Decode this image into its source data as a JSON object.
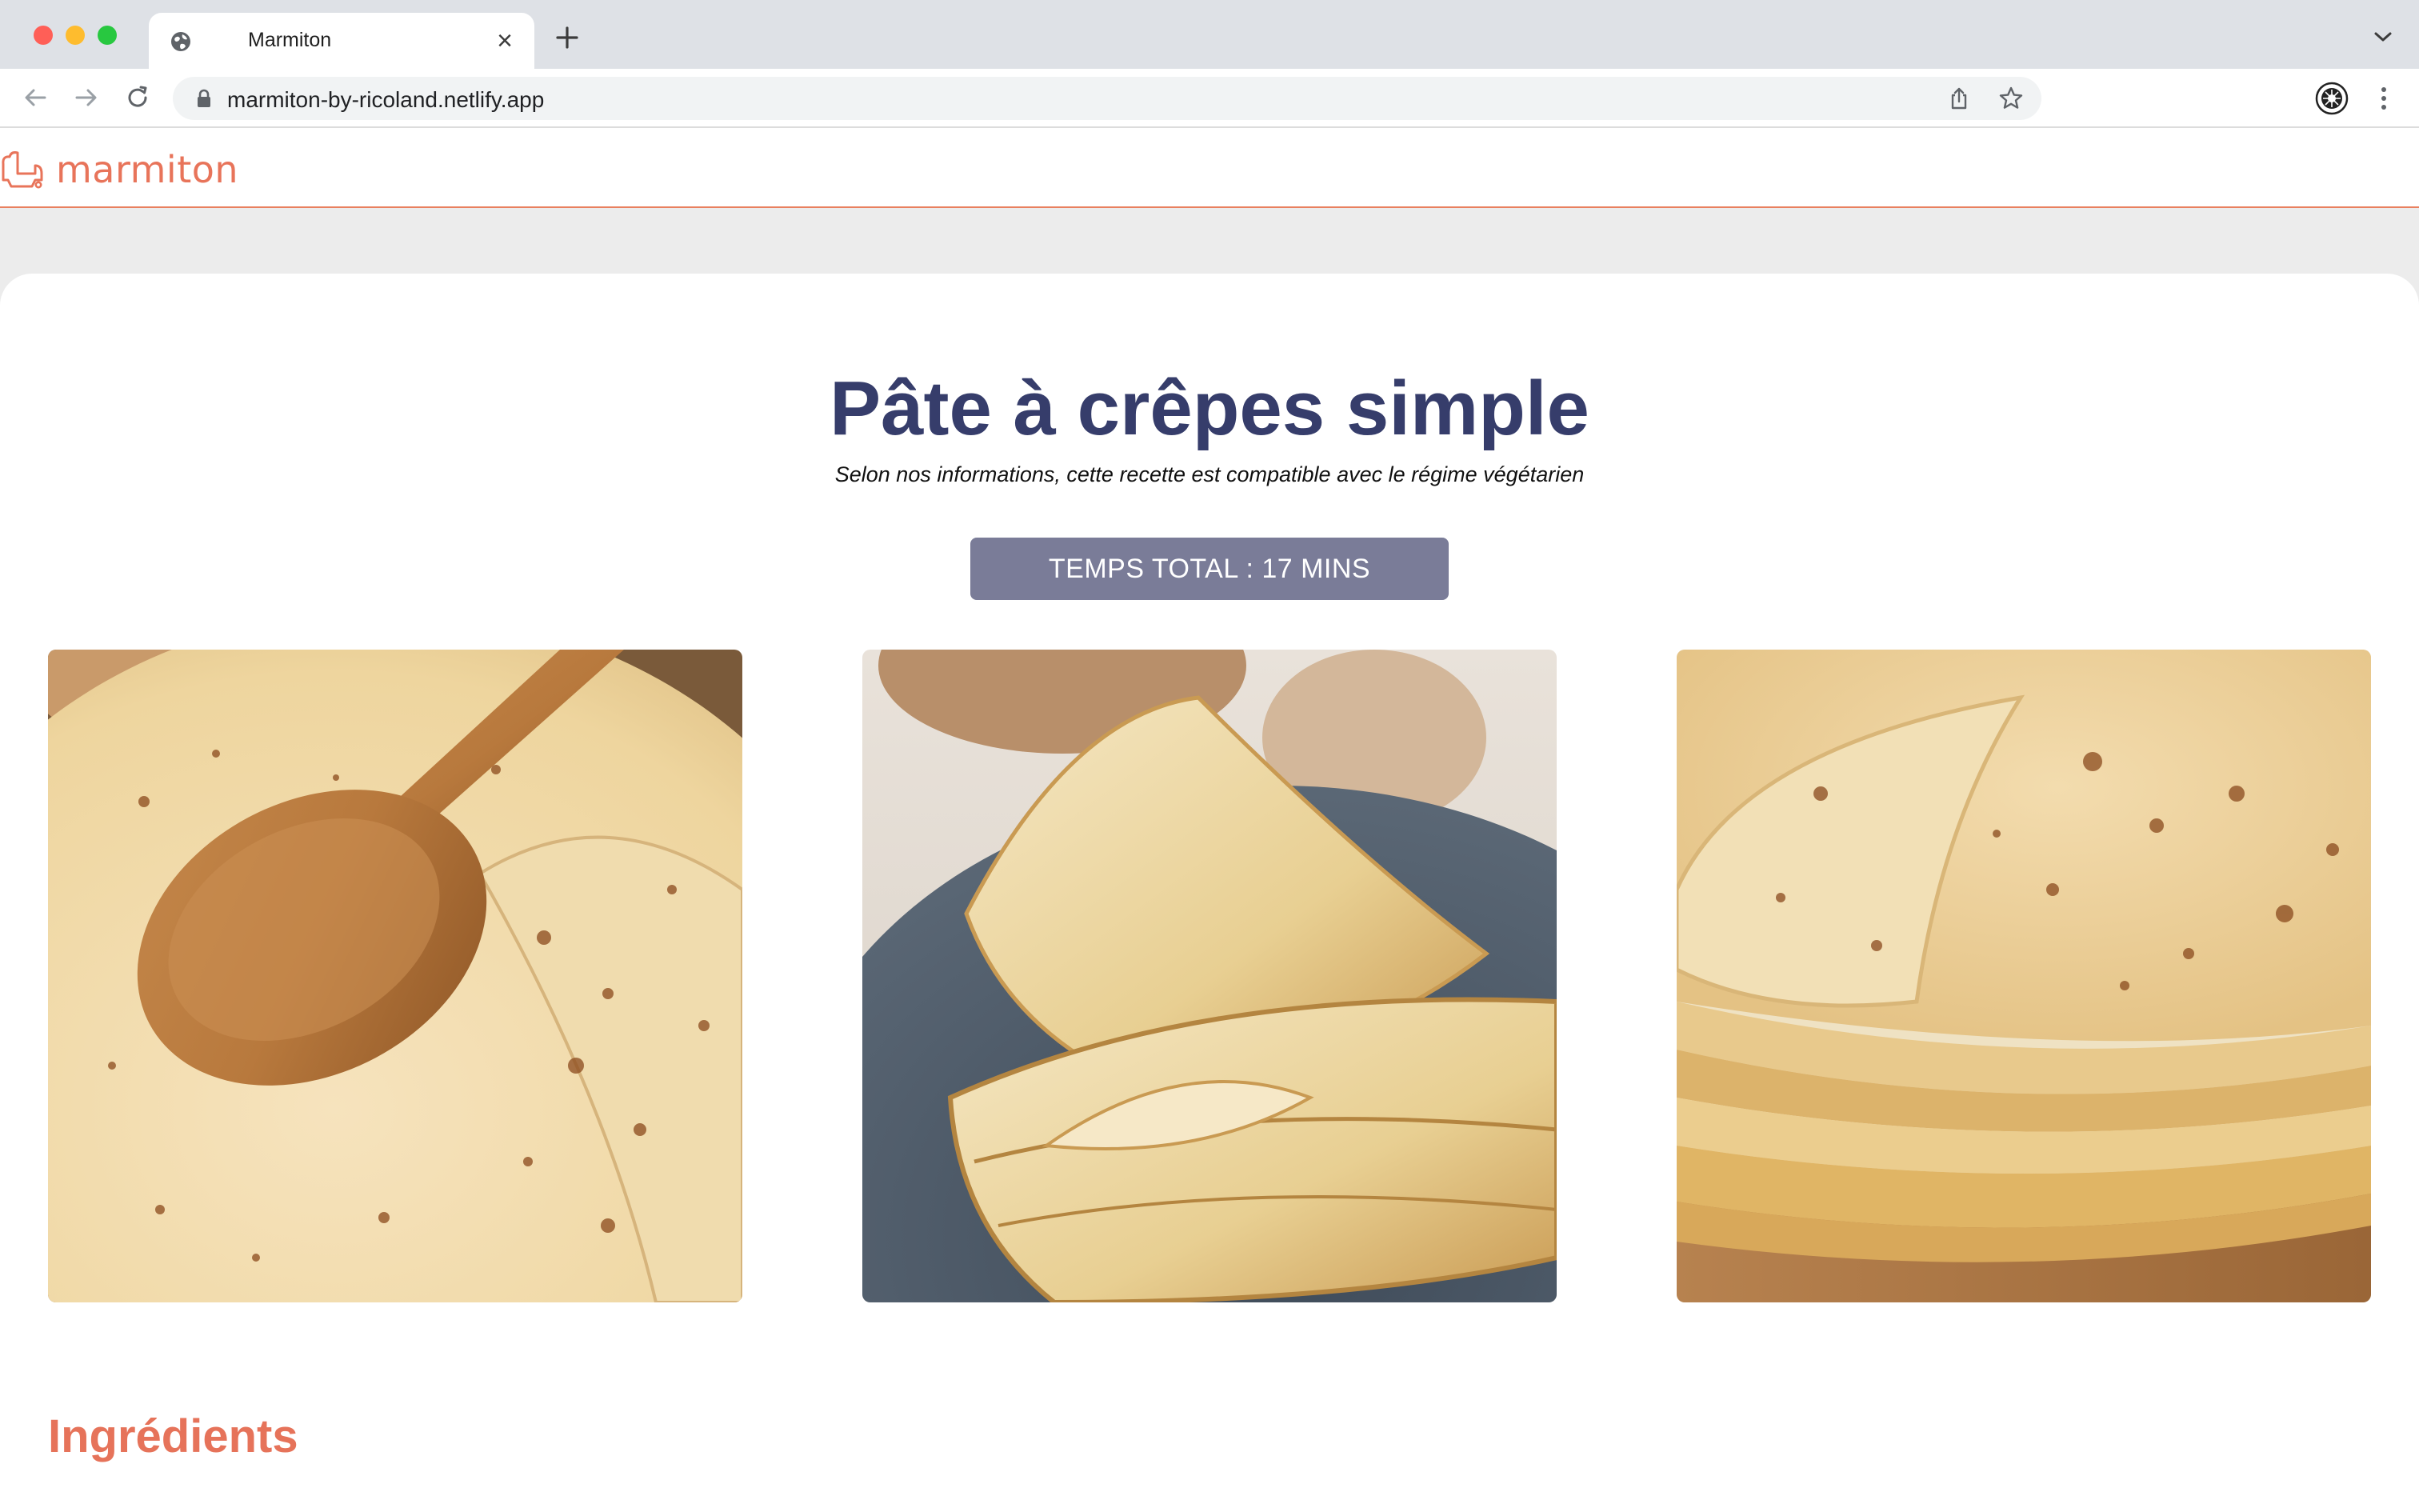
{
  "browser": {
    "tab": {
      "title": "Marmiton",
      "favicon": "globe-icon"
    },
    "url": "marmiton-by-ricoland.netlify.app",
    "colors": {
      "tabstrip": "#dee1e6",
      "omnibox": "#f1f3f4"
    }
  },
  "site": {
    "logo_text": "marmiton",
    "brand_color": "#e8745a"
  },
  "recipe": {
    "title": "Pâte à crêpes simple",
    "subtitle": "Selon nos informations, cette recette est compatible avec le régime végétarien",
    "total_time": "TEMPS TOTAL : 17 MINS",
    "title_color": "#363d6b",
    "badge_color": "#7a7c98",
    "photos": [
      {
        "subject": "crepes-with-wooden-spoon"
      },
      {
        "subject": "folded-crepes-on-plate"
      },
      {
        "subject": "stack-of-crepes"
      }
    ],
    "ingredients_heading": "Ingrédients"
  }
}
